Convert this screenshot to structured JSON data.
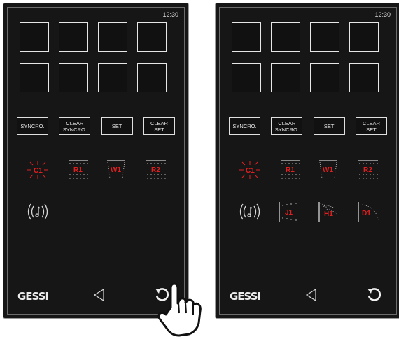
{
  "screens": [
    {
      "time": "12:30",
      "buttons": [
        {
          "label": "SYNCRO."
        },
        {
          "label": "CLEAR\nSYNCRO."
        },
        {
          "label": "SET"
        },
        {
          "label": "CLEAR\nSET"
        }
      ],
      "spray_modes": [
        {
          "label": "C1",
          "icon": "sunburst-icon"
        },
        {
          "label": "R1",
          "icon": "rain-dots-icon"
        },
        {
          "label": "W1",
          "icon": "waterfall-icon"
        },
        {
          "label": "R2",
          "icon": "rain-dots-icon"
        }
      ],
      "extra_modes": [
        {
          "icon": "sound-wave-icon"
        }
      ],
      "footer": {
        "logo": "GESSI",
        "back_icon": "back-triangle-icon",
        "reload_icon": "reload-icon"
      }
    },
    {
      "time": "12:30",
      "buttons": [
        {
          "label": "SYNCRO."
        },
        {
          "label": "CLEAR\nSYNCRO."
        },
        {
          "label": "SET"
        },
        {
          "label": "CLEAR\nSET"
        }
      ],
      "spray_modes": [
        {
          "label": "C1",
          "icon": "sunburst-icon"
        },
        {
          "label": "R1",
          "icon": "rain-dots-icon"
        },
        {
          "label": "W1",
          "icon": "waterfall-icon"
        },
        {
          "label": "R2",
          "icon": "rain-dots-icon"
        }
      ],
      "extra_modes": [
        {
          "icon": "sound-wave-icon"
        },
        {
          "label": "J1",
          "icon": "side-jet-icon"
        },
        {
          "label": "H1",
          "icon": "hand-shower-icon"
        },
        {
          "label": "D1",
          "icon": "diagonal-jet-icon"
        }
      ],
      "footer": {
        "logo": "GESSI",
        "back_icon": "back-triangle-icon",
        "reload_icon": "reload-icon"
      }
    }
  ],
  "overlay": {
    "icon": "tap-hand-icon"
  }
}
